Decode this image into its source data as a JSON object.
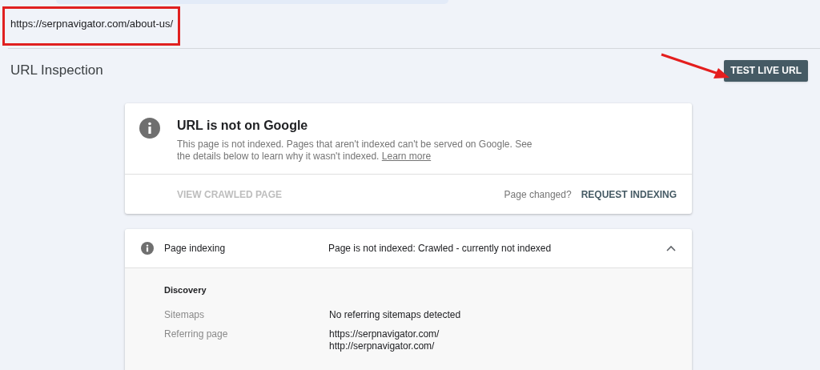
{
  "url_bar": {
    "url": "https://serpnavigator.com/about-us/"
  },
  "header": {
    "title": "URL Inspection",
    "button": "TEST LIVE URL"
  },
  "status_card": {
    "title": "URL is not on Google",
    "description": "This page is not indexed. Pages that aren't indexed can't be served on Google. See the details below to learn why it wasn't indexed.",
    "link": "Learn more",
    "actions": [
      {
        "label": "VIEW CRAWLED PAGE",
        "disabled": true
      }
    ],
    "prompt": "Page changed?",
    "primary_action": {
      "label": "REQUEST INDEXING",
      "disabled": false
    }
  },
  "indexing_card": {
    "label": "Page indexing",
    "status": "Page is not indexed: Crawled - currently not indexed",
    "expanded": true,
    "section": "Discovery",
    "rows": [
      {
        "label": "Sitemaps",
        "values": [
          "No referring sitemaps detected"
        ]
      },
      {
        "label": "Referring page",
        "values": [
          "https://serpnavigator.com/",
          "http://serpnavigator.com/"
        ]
      }
    ]
  }
}
